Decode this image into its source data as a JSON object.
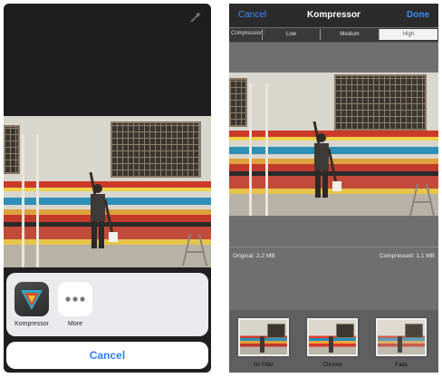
{
  "left_screen": {
    "share_sheet": {
      "apps": [
        {
          "label": "Kompressor",
          "icon": "kompressor-app-icon"
        },
        {
          "label": "More",
          "icon": "more-dots-icon"
        }
      ],
      "cancel_label": "Cancel"
    },
    "icons": {
      "magic_wand": "magic-wand-icon"
    }
  },
  "right_screen": {
    "nav": {
      "cancel_label": "Cancel",
      "title": "Kompressor",
      "done_label": "Done"
    },
    "compression": {
      "label": "Compression:",
      "options": [
        "Low",
        "Medium",
        "High"
      ],
      "selected": "High"
    },
    "sizes": {
      "original": "Original: 2.2 MB",
      "compressed": "Compressed: 1.1 MB"
    },
    "filters": [
      {
        "label": "No Filter"
      },
      {
        "label": "Chrome"
      },
      {
        "label": "Fade"
      }
    ]
  },
  "colors": {
    "accent": "#2f7df7",
    "nav_bg": "#2b2b2b",
    "sheet_bg": "#e9e9ee"
  }
}
